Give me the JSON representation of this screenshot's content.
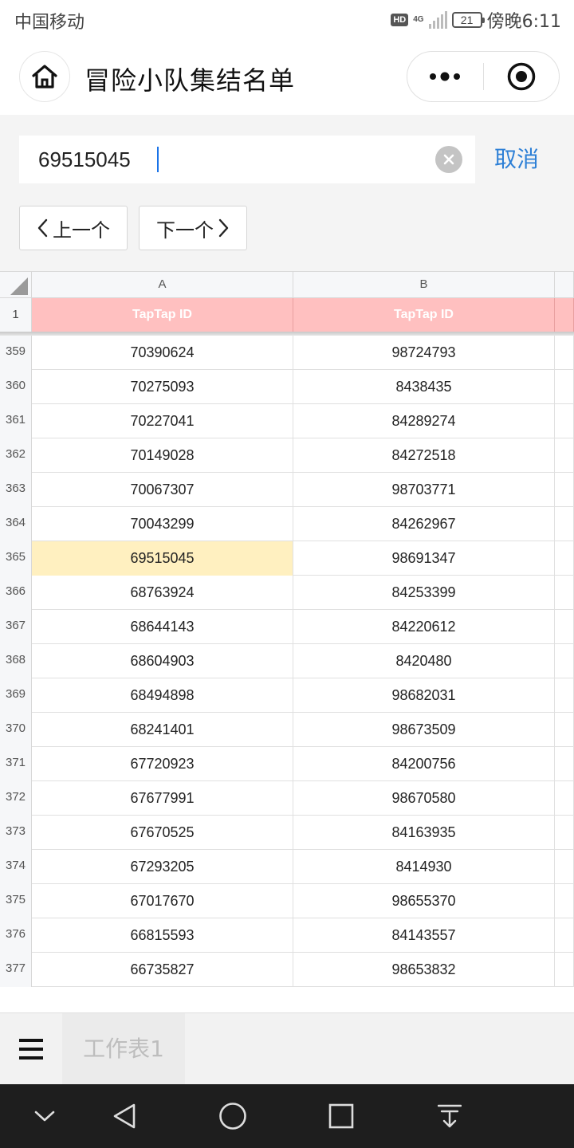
{
  "status_bar": {
    "carrier": "中国移动",
    "hd": "HD",
    "network": "4G",
    "battery": "21",
    "time": "傍晚6:11"
  },
  "header": {
    "title": "冒险小队集结名单",
    "icons": [
      "home-icon",
      "more-dots-icon",
      "close-target-icon"
    ]
  },
  "search": {
    "value": "69515045",
    "cancel_label": "取消",
    "prev_label": "上一个",
    "next_label": "下一个"
  },
  "sheet": {
    "columns": [
      "A",
      "B"
    ],
    "header_row": {
      "num": "1",
      "a": "TapTap ID",
      "b": "TapTap ID"
    },
    "rows": [
      {
        "num": "359",
        "a": "70390624",
        "b": "98724793"
      },
      {
        "num": "360",
        "a": "70275093",
        "b": "8438435"
      },
      {
        "num": "361",
        "a": "70227041",
        "b": "84289274"
      },
      {
        "num": "362",
        "a": "70149028",
        "b": "84272518"
      },
      {
        "num": "363",
        "a": "70067307",
        "b": "98703771"
      },
      {
        "num": "364",
        "a": "70043299",
        "b": "84262967"
      },
      {
        "num": "365",
        "a": "69515045",
        "b": "98691347",
        "highlight": true
      },
      {
        "num": "366",
        "a": "68763924",
        "b": "84253399"
      },
      {
        "num": "367",
        "a": "68644143",
        "b": "84220612"
      },
      {
        "num": "368",
        "a": "68604903",
        "b": "8420480"
      },
      {
        "num": "369",
        "a": "68494898",
        "b": "98682031"
      },
      {
        "num": "370",
        "a": "68241401",
        "b": "98673509"
      },
      {
        "num": "371",
        "a": "67720923",
        "b": "84200756"
      },
      {
        "num": "372",
        "a": "67677991",
        "b": "98670580"
      },
      {
        "num": "373",
        "a": "67670525",
        "b": "84163935"
      },
      {
        "num": "374",
        "a": "67293205",
        "b": "8414930"
      },
      {
        "num": "375",
        "a": "67017670",
        "b": "98655370"
      },
      {
        "num": "376",
        "a": "66815593",
        "b": "84143557"
      },
      {
        "num": "377",
        "a": "66735827",
        "b": "98653832"
      }
    ],
    "highlight_color": "#fff0c0",
    "header_color": "#ffc0c0"
  },
  "tabs": {
    "menu_icon": "hamburger-icon",
    "sheet_name": "工作表1"
  },
  "nav_bar": {
    "icons": [
      "hide-keyboard-icon",
      "back-icon",
      "home-circle-icon",
      "recents-icon",
      "notification-pull-icon"
    ]
  },
  "colors": {
    "accent": "#2c7fd6",
    "caret": "#1a73e8"
  }
}
